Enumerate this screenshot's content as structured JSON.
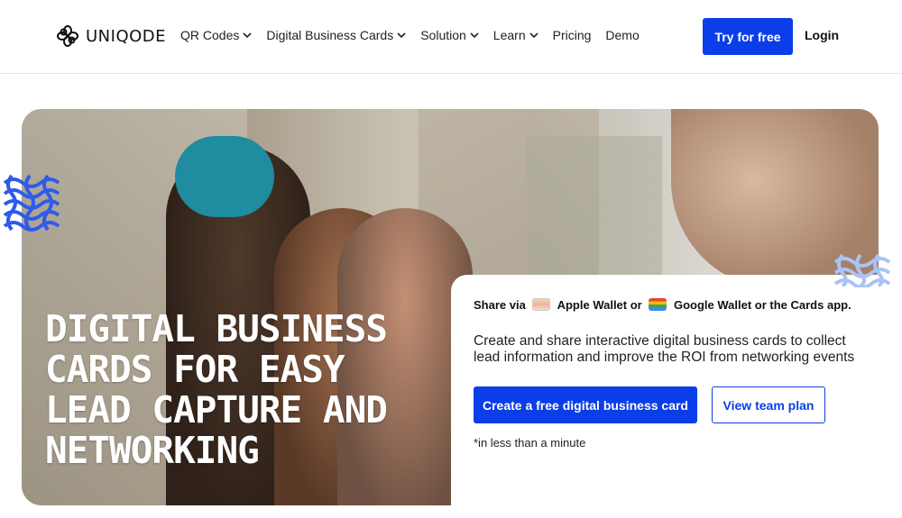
{
  "header": {
    "brand": "UNIQODE",
    "nav": [
      {
        "label": "QR Codes",
        "dropdown": true
      },
      {
        "label": "Digital Business Cards",
        "dropdown": true
      },
      {
        "label": "Solution",
        "dropdown": true
      },
      {
        "label": "Learn",
        "dropdown": true
      },
      {
        "label": "Pricing",
        "dropdown": false
      },
      {
        "label": "Demo",
        "dropdown": false
      }
    ],
    "try_button": "Try for free",
    "login_button": "Login"
  },
  "hero": {
    "title": "DIGITAL BUSINESS CARDS FOR EASY LEAD CAPTURE AND NETWORKING",
    "card": {
      "share_prefix": "Share via",
      "apple_wallet": "Apple Wallet or",
      "google_wallet": "Google Wallet or the Cards app.",
      "description": "Create and share interactive digital business cards to collect lead information and improve the ROI from networking events",
      "primary_button": "Create a free digital business card",
      "secondary_button": "View team plan",
      "note": "*in less than a minute"
    }
  },
  "colors": {
    "accent": "#0b3ee8",
    "knot": "#2f5be8"
  },
  "icons": [
    "uniqode-logo-icon",
    "chevron-down-icon",
    "apple-wallet-icon",
    "google-wallet-icon",
    "knot-decoration-icon"
  ]
}
